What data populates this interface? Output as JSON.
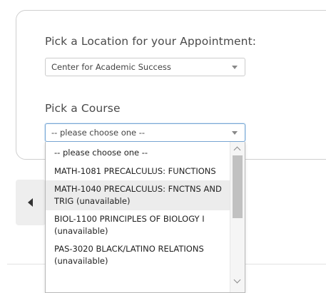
{
  "location": {
    "heading": "Pick a Location for your Appointment:",
    "selected": "Center for Academic Success"
  },
  "course": {
    "heading": "Pick a Course",
    "selected": "-- please choose one --",
    "options": [
      "-- please choose one --",
      "MATH-1081 PRECALCULUS: FUNCTIONS",
      "MATH-1040 PRECALCULUS: FNCTNS AND TRIG (unavailable)",
      "BIOL-1100 PRINCIPLES OF BIOLOGY I (unavailable)",
      "PAS-3020 BLACK/LATINO RELATIONS (unavailable)"
    ]
  },
  "icons": {
    "back": "chevron-left-icon",
    "select_caret": "caret-down-icon",
    "scroll_up": "scroll-up-icon",
    "scroll_down": "scroll-down-icon"
  },
  "colors": {
    "card_border": "#cfcfcf",
    "focus_border": "#79a9d6",
    "highlight": "#ececec",
    "scroll_thumb": "#c1c1c1"
  }
}
